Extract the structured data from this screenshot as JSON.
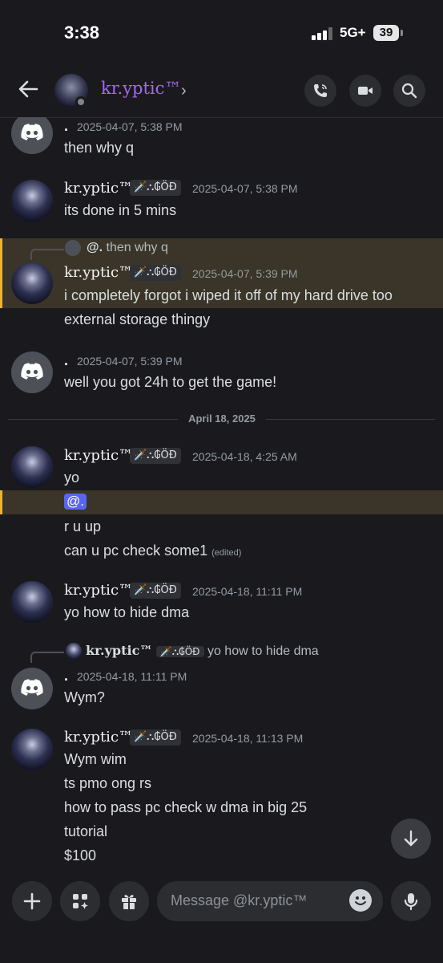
{
  "status_bar": {
    "time": "3:38",
    "network": "5G+",
    "battery": "39"
  },
  "header": {
    "name": "kr.yptic™",
    "chevron": "›",
    "icons": [
      "back-arrow-icon",
      "phone-call-icon",
      "video-camera-icon",
      "search-icon"
    ]
  },
  "messages": [
    {
      "author": ".",
      "timestamp": "2025-04-07, 5:38 PM",
      "lines": [
        "then why q"
      ],
      "avatar": "discord-logo-icon"
    },
    {
      "author": "kr.yptic™",
      "tag": "🗡️⛬₲ӦĐ",
      "timestamp": "2025-04-07, 5:38 PM",
      "lines": [
        "its done in 5 mins"
      ]
    },
    {
      "reply_author": "@.",
      "reply_text": "then why q",
      "author": "kr.yptic™",
      "tag": "🗡️⛬₲ӦĐ",
      "timestamp": "2025-04-07, 5:39 PM",
      "lines": [
        "i completely forgot i wiped it off of my hard drive too",
        "external storage thingy"
      ]
    },
    {
      "author": ".",
      "timestamp": "2025-04-07, 5:39 PM",
      "lines": [
        "well you got 24h to get the game!"
      ],
      "avatar": "discord-logo-icon"
    },
    {
      "author": "kr.yptic™",
      "tag": "🗡️⛬₲ӦĐ",
      "timestamp": "2025-04-18, 4:25 AM",
      "lines": [
        "yo",
        "@.",
        "r u up",
        "can u pc check some1"
      ],
      "edited": "(edited)"
    },
    {
      "author": "kr.yptic™",
      "tag": "🗡️⛬₲ӦĐ",
      "timestamp": "2025-04-18, 11:11 PM",
      "lines": [
        "yo how to hide dma"
      ]
    },
    {
      "reply_author": "kr.yptic™",
      "reply_tag": "🗡️⛬₲ӦĐ",
      "reply_text": "yo how to hide dma",
      "author": ".",
      "timestamp": "2025-04-18, 11:11 PM",
      "lines": [
        "Wym?"
      ],
      "avatar": "discord-logo-icon"
    },
    {
      "author": "kr.yptic™",
      "tag": "🗡️⛬₲ӦĐ",
      "timestamp": "2025-04-18, 11:13 PM",
      "lines": [
        "Wym wim",
        "ts pmo ong rs",
        "how to pass pc check w dma in big 25",
        "tutorial",
        "$100"
      ]
    }
  ],
  "date_divider": "April 18, 2025",
  "composer": {
    "placeholder": "Message @kr.yptic™",
    "icons": [
      "plus-icon",
      "apps-icon",
      "gift-icon",
      "emoji-icon",
      "microphone-icon"
    ]
  },
  "colors": {
    "background": "#1a1a1e",
    "accent_name": "#a36af2",
    "highlight": "#3a3528",
    "highlight_bar": "#f0b232",
    "mention": "#5865f2"
  }
}
